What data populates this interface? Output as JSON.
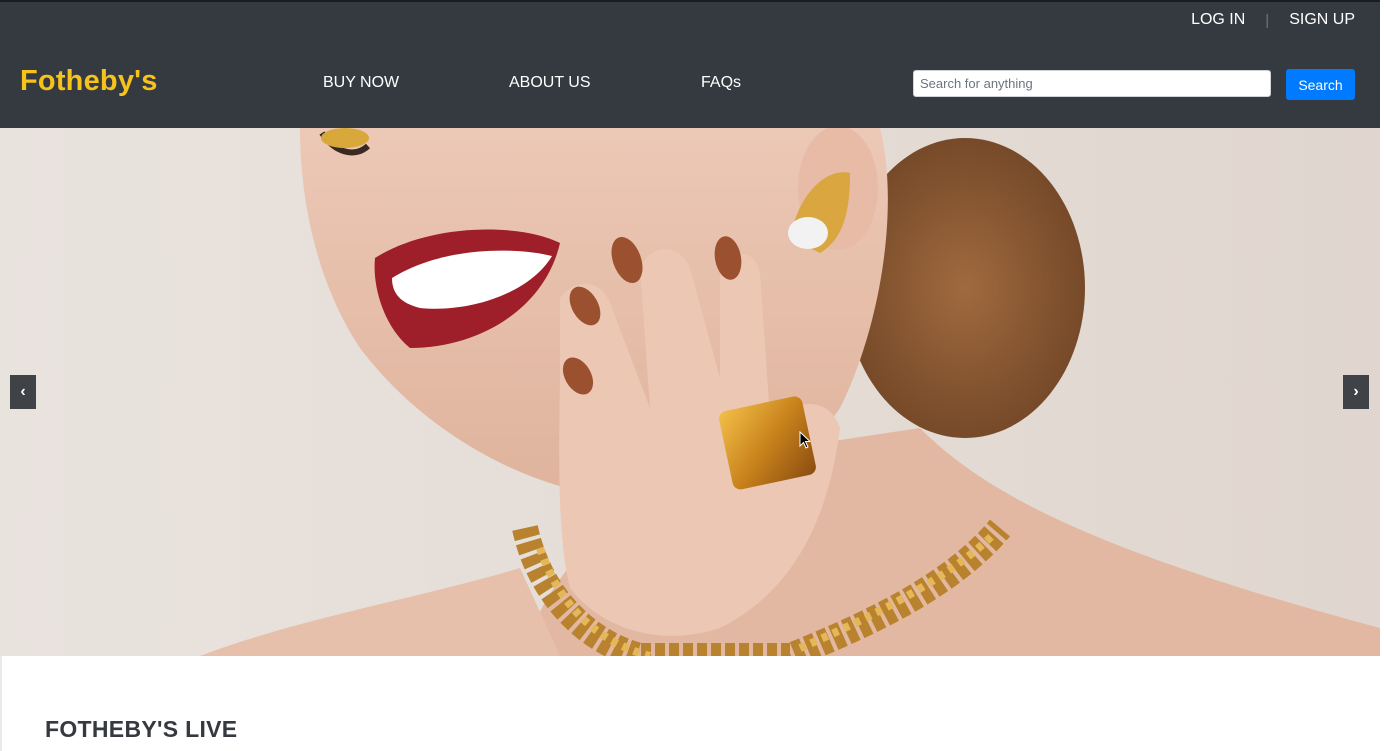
{
  "header": {
    "brand": "Fotheby's",
    "brand_color": "#f6c21c",
    "background_color": "#343a40",
    "auth": {
      "login": "LOG IN",
      "separator": "|",
      "signup": "SIGN UP"
    },
    "nav": [
      {
        "label": "BUY NOW"
      },
      {
        "label": "ABOUT US"
      },
      {
        "label": "FAQs"
      }
    ],
    "search": {
      "placeholder": "Search for anything",
      "value": "",
      "button_label": "Search",
      "button_color": "#007bff"
    }
  },
  "carousel": {
    "image": "jewelry-model-photo",
    "prev_label": "‹",
    "next_label": "›",
    "prev_icon": "chevron-left-icon",
    "next_icon": "chevron-right-icon"
  },
  "main": {
    "section_title": "FOTHEBY'S LIVE"
  }
}
